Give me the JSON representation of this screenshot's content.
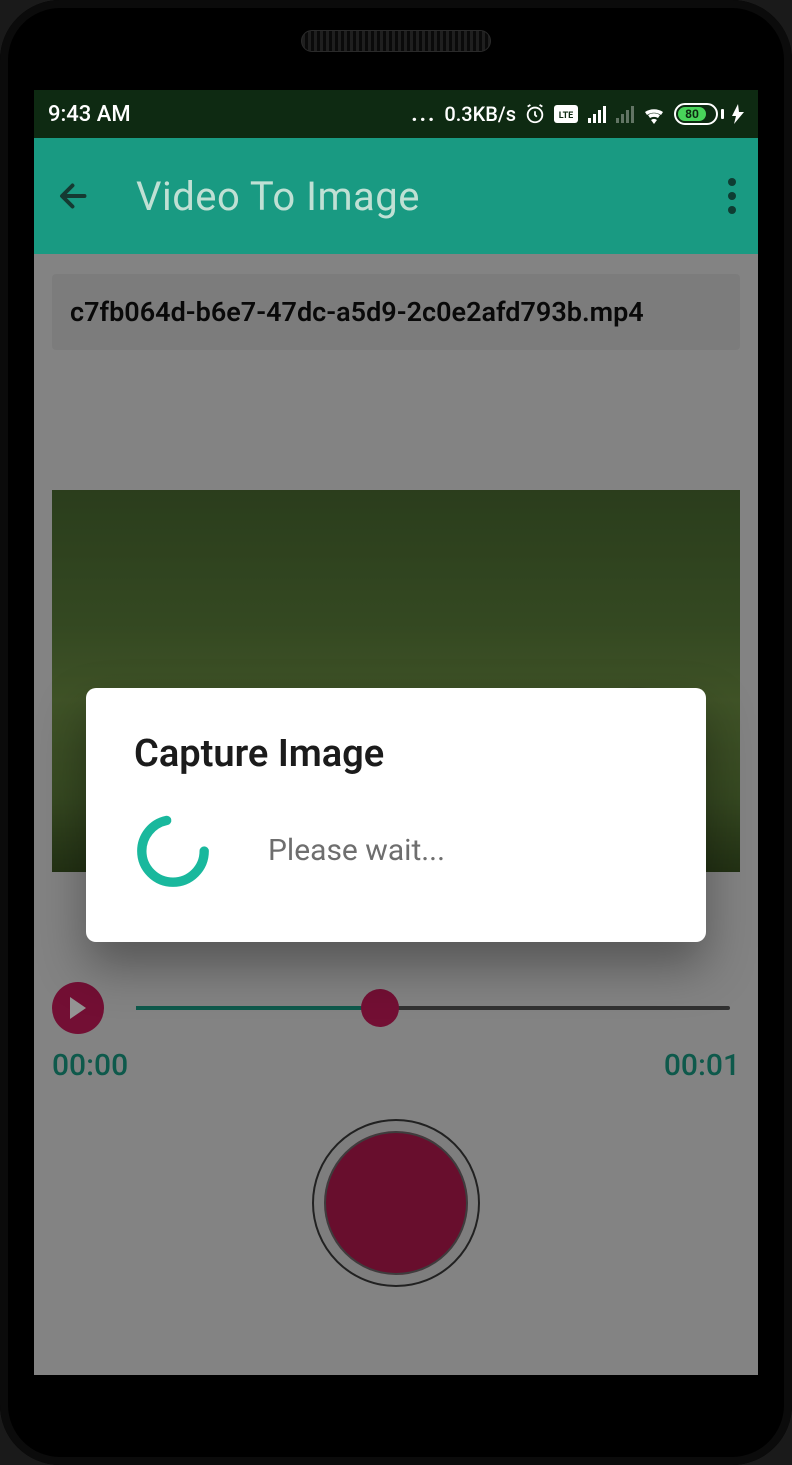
{
  "statusbar": {
    "time": "9:43 AM",
    "network_speed": "0.3KB/s",
    "battery_pct": "80"
  },
  "appbar": {
    "title": "Video To Image"
  },
  "file": {
    "name": "c7fb064d-b6e7-47dc-a5d9-2c0e2afd793b.mp4"
  },
  "player": {
    "current_time": "00:00",
    "duration": "00:01",
    "progress_pct": 41
  },
  "dialog": {
    "title": "Capture Image",
    "message": "Please wait..."
  },
  "colors": {
    "accent": "#199a82",
    "magenta": "#c61a5b",
    "statusbar_bg": "#0e2a12"
  }
}
